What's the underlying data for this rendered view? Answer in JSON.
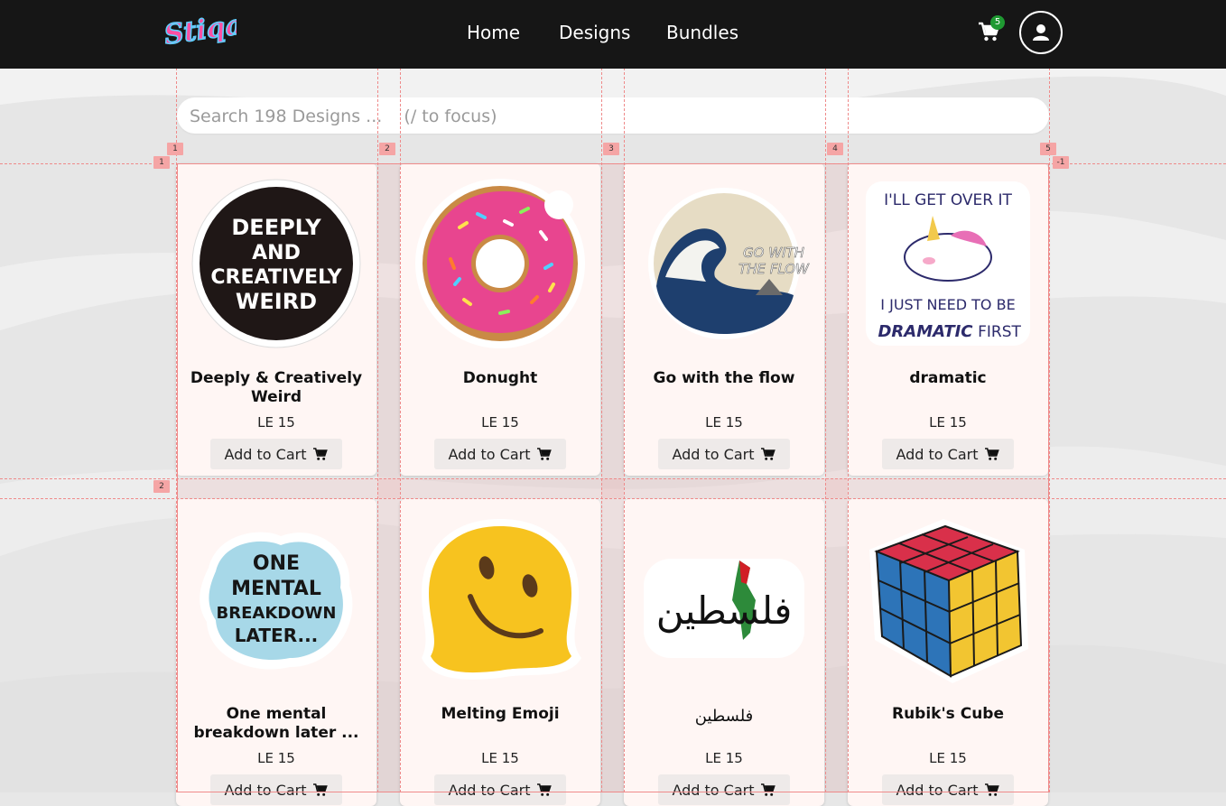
{
  "brand": {
    "logo_text": "Stiqa"
  },
  "nav": {
    "items": [
      "Home",
      "Designs",
      "Bundles"
    ]
  },
  "cart": {
    "count": "5"
  },
  "search": {
    "placeholder": "Search 198 Designs ...    (/ to focus)"
  },
  "products": [
    {
      "name": "Deeply & Creatively Weird",
      "price": "LE 15",
      "button": "Add to Cart",
      "art": [
        "DEEPLY",
        "AND",
        "CREATIVELY",
        "WEIRD"
      ]
    },
    {
      "name": "Donught",
      "price": "LE 15",
      "button": "Add to Cart"
    },
    {
      "name": "Go with the flow",
      "price": "LE 15",
      "button": "Add to Cart",
      "art": [
        "GO WITH",
        "THE FLOW"
      ]
    },
    {
      "name": "dramatic",
      "price": "LE 15",
      "button": "Add to Cart",
      "art": [
        "I'LL GET OVER IT",
        "I JUST NEED TO BE",
        "DRAMATIC",
        "FIRST"
      ]
    },
    {
      "name": "One mental breakdown later ...",
      "price": "LE 15",
      "button": "Add to Cart",
      "art": [
        "ONE",
        "MENTAL",
        "BREAKDOWN",
        "LATER..."
      ]
    },
    {
      "name": "Melting Emoji",
      "price": "LE 15",
      "button": "Add to Cart"
    },
    {
      "name": "فلسطين",
      "price": "LE 15",
      "button": "Add to Cart",
      "art": [
        "فلسطين"
      ]
    },
    {
      "name": "Rubik's Cube",
      "price": "LE 15",
      "button": "Add to Cart"
    }
  ],
  "overlay": {
    "column_markers": [
      "1",
      "2",
      "3",
      "4",
      "5"
    ],
    "row_markers": [
      "1",
      "2",
      "-1"
    ]
  },
  "colors": {
    "header": "#161616",
    "card": "#fff6f4",
    "badge": "#1f9a32",
    "guide": "#ef8a8a"
  }
}
